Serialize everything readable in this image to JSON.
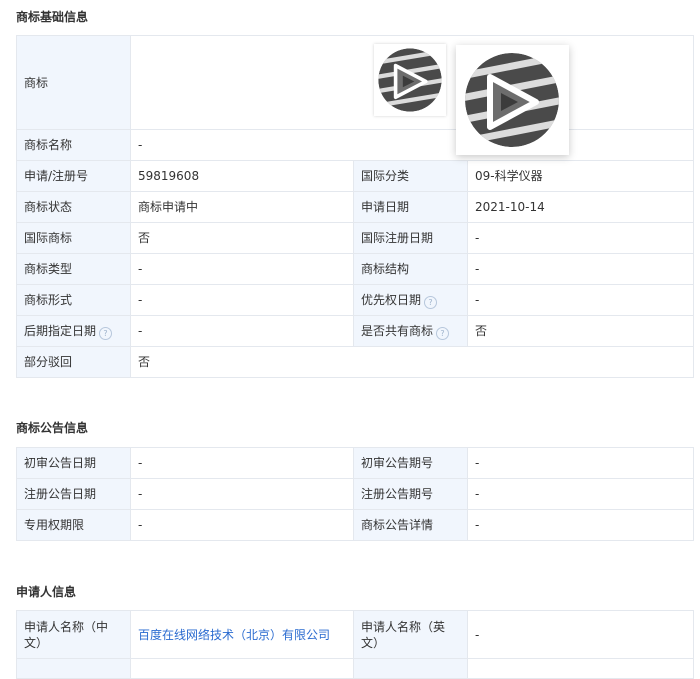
{
  "basic": {
    "title": "商标基础信息",
    "trademark_label": "商标",
    "rows": [
      {
        "label": "商标名称",
        "value": "-"
      },
      {
        "label": "申请/注册号",
        "value": "59819608",
        "label2": "国际分类",
        "value2": "09-科学仪器"
      },
      {
        "label": "商标状态",
        "value": "商标申请中",
        "label2": "申请日期",
        "value2": "2021-10-14"
      },
      {
        "label": "国际商标",
        "value": "否",
        "label2": "国际注册日期",
        "value2": "-"
      },
      {
        "label": "商标类型",
        "value": "-",
        "label2": "商标结构",
        "value2": "-"
      },
      {
        "label": "商标形式",
        "value": "-",
        "label2": "优先权日期",
        "value2": "-"
      },
      {
        "label": "后期指定日期",
        "value": "-",
        "label2": "是否共有商标",
        "value2": "否"
      },
      {
        "label": "部分驳回",
        "value": "否"
      }
    ],
    "help_glyph": "?"
  },
  "notice": {
    "title": "商标公告信息",
    "rows": [
      {
        "label": "初审公告日期",
        "value": "-",
        "label2": "初审公告期号",
        "value2": "-"
      },
      {
        "label": "注册公告日期",
        "value": "-",
        "label2": "注册公告期号",
        "value2": "-"
      },
      {
        "label": "专用权期限",
        "value": "-",
        "label2": "商标公告详情",
        "value2": "-"
      }
    ]
  },
  "applicant": {
    "title": "申请人信息",
    "rows": [
      {
        "label": "申请人名称（中文）",
        "value": "百度在线网络技术（北京）有限公司",
        "label2": "申请人名称（英文）",
        "value2": "-"
      }
    ]
  },
  "colors": {
    "label_bg": "#f1f6fd",
    "border": "#e4e8ee",
    "link": "#2a6bd0"
  }
}
